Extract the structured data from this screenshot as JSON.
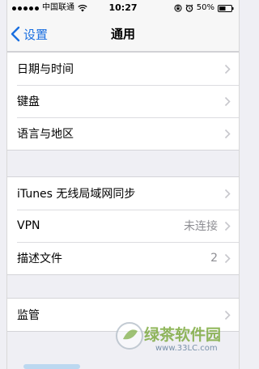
{
  "status_bar": {
    "carrier": "中国联通",
    "time": "10:27",
    "battery": "50%"
  },
  "nav": {
    "back_label": "设置",
    "title": "通用"
  },
  "groups": [
    {
      "rows": [
        {
          "label": "日期与时间"
        },
        {
          "label": "键盘"
        },
        {
          "label": "语言与地区"
        }
      ]
    },
    {
      "rows": [
        {
          "label": "iTunes 无线局域网同步"
        },
        {
          "label": "VPN",
          "value": "未连接"
        },
        {
          "label": "描述文件",
          "value": "2"
        }
      ]
    },
    {
      "rows": [
        {
          "label": "监管"
        }
      ]
    }
  ],
  "watermark": {
    "title": "绿茶软件园",
    "url": "www.33LC.com"
  },
  "colors": {
    "accent": "#1a6fe0",
    "background": "#efeff4",
    "secondary_text": "#8e8e93"
  },
  "icons": [
    "wifi-icon",
    "rotation-lock-icon",
    "alarm-icon",
    "battery-icon",
    "chevron-left-icon",
    "chevron-right-icon"
  ]
}
